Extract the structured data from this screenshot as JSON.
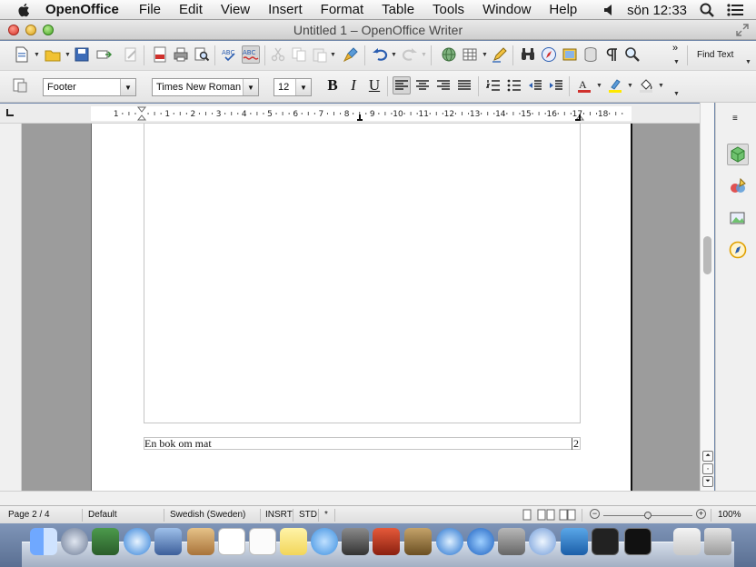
{
  "menubar": {
    "app_name": "OpenOffice",
    "items": [
      "File",
      "Edit",
      "View",
      "Insert",
      "Format",
      "Table",
      "Tools",
      "Window",
      "Help"
    ],
    "clock": "sön 12:33"
  },
  "window": {
    "title": "Untitled 1 – OpenOffice Writer"
  },
  "toolbar1": {
    "find_text_label": "Find Text"
  },
  "toolbar2": {
    "paragraph_style": "Footer",
    "font_name": "Times New Roman",
    "font_size": "12",
    "bold_label": "B",
    "italic_label": "I",
    "underline_label": "U"
  },
  "ruler": {
    "labels": [
      "1",
      "1",
      "2",
      "3",
      "4",
      "5",
      "6",
      "7",
      "8",
      "9",
      "10",
      "11",
      "12",
      "13",
      "14",
      "15",
      "16",
      "17",
      "18"
    ]
  },
  "document": {
    "footer_text": "En bok om mat",
    "footer_page_number": "2"
  },
  "statusbar": {
    "page": "Page 2 / 4",
    "page_style": "Default",
    "language": "Swedish (Sweden)",
    "insert_mode": "INSRT",
    "selection_mode": "STD",
    "modified": "*",
    "zoom": "100%",
    "zoom_level_percent": 100
  },
  "icons": {
    "accent": "#2a5db0"
  }
}
